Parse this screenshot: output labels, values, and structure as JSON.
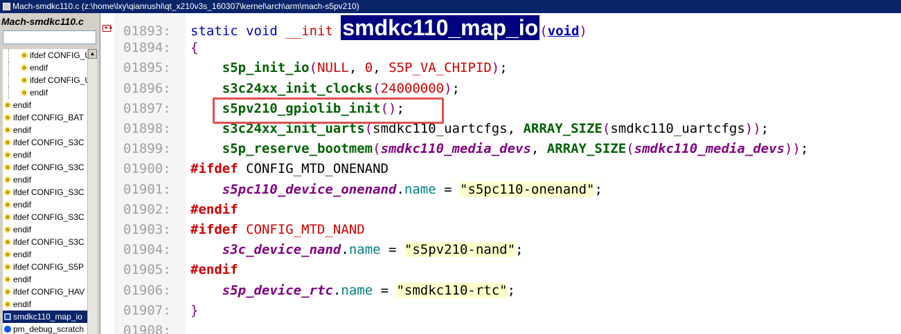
{
  "titlebar": {
    "text": "Mach-smdkc110.c (z:\\home\\lxy\\qianrushi\\qt_x210v3s_160307\\kernel\\arch\\arm\\mach-s5pv210)"
  },
  "sidebar": {
    "title": "Mach-smdkc110.c",
    "search_value": "",
    "items": [
      {
        "label": "ifdef CONFIG_U",
        "icon": "preprocessor-icon",
        "nested": true
      },
      {
        "label": "endif",
        "icon": "preprocessor-icon",
        "nested": true
      },
      {
        "label": "ifdef CONFIG_U",
        "icon": "preprocessor-icon",
        "nested": true
      },
      {
        "label": "endif",
        "icon": "preprocessor-icon",
        "nested": true
      },
      {
        "label": "endif",
        "icon": "preprocessor-icon",
        "nested": false
      },
      {
        "label": "ifdef CONFIG_BAT",
        "icon": "preprocessor-icon",
        "nested": false
      },
      {
        "label": "endif",
        "icon": "preprocessor-icon",
        "nested": false
      },
      {
        "label": "ifdef CONFIG_S3C",
        "icon": "preprocessor-icon",
        "nested": false
      },
      {
        "label": "endif",
        "icon": "preprocessor-icon",
        "nested": false
      },
      {
        "label": "ifdef CONFIG_S3C",
        "icon": "preprocessor-icon",
        "nested": false
      },
      {
        "label": "endif",
        "icon": "preprocessor-icon",
        "nested": false
      },
      {
        "label": "ifdef CONFIG_S3C",
        "icon": "preprocessor-icon",
        "nested": false
      },
      {
        "label": "endif",
        "icon": "preprocessor-icon",
        "nested": false
      },
      {
        "label": "ifdef CONFIG_S3C",
        "icon": "preprocessor-icon",
        "nested": false
      },
      {
        "label": "endif",
        "icon": "preprocessor-icon",
        "nested": false
      },
      {
        "label": "ifdef CONFIG_S3C",
        "icon": "preprocessor-icon",
        "nested": false
      },
      {
        "label": "endif",
        "icon": "preprocessor-icon",
        "nested": false
      },
      {
        "label": "ifdef CONFIG_S5P",
        "icon": "preprocessor-icon",
        "nested": false
      },
      {
        "label": "endif",
        "icon": "preprocessor-icon",
        "nested": false
      },
      {
        "label": "ifdef CONFIG_HAV",
        "icon": "preprocessor-icon",
        "nested": false
      },
      {
        "label": "endif",
        "icon": "preprocessor-icon",
        "nested": false
      },
      {
        "label": "smdkc110_map_io",
        "icon": "function-icon",
        "nested": false,
        "selected": true
      },
      {
        "label": "pm_debug_scratch",
        "icon": "variable-icon",
        "nested": false
      }
    ]
  },
  "editor": {
    "lines": [
      {
        "num": "01893:",
        "tokens": [
          [
            "kw",
            "static "
          ],
          [
            "kw",
            "void "
          ],
          [
            "mac",
            "__init "
          ],
          [
            "hl",
            "smdkc110_map_io"
          ],
          [
            "paren",
            "("
          ],
          [
            "void",
            "void"
          ],
          [
            "paren",
            ")"
          ]
        ]
      },
      {
        "num": "01894:",
        "tokens": [
          [
            "paren",
            "{"
          ]
        ]
      },
      {
        "num": "01895:",
        "tokens": [
          [
            "plain",
            "    "
          ],
          [
            "fn",
            "s5p_init_io"
          ],
          [
            "paren",
            "("
          ],
          [
            "mac",
            "NULL"
          ],
          [
            "plain",
            ", "
          ],
          [
            "num",
            "0"
          ],
          [
            "plain",
            ", "
          ],
          [
            "mac",
            "S5P_VA_CHIPID"
          ],
          [
            "paren",
            ")"
          ],
          [
            "plain",
            ";"
          ]
        ]
      },
      {
        "num": "01896:",
        "tokens": [
          [
            "plain",
            "    "
          ],
          [
            "fn",
            "s3c24xx_init_clocks"
          ],
          [
            "paren",
            "("
          ],
          [
            "num",
            "24000000"
          ],
          [
            "paren",
            ")"
          ],
          [
            "plain",
            ";"
          ]
        ]
      },
      {
        "num": "01897:",
        "tokens": [
          [
            "plain",
            "    "
          ],
          [
            "fn",
            "s5pv210_gpiolib_init"
          ],
          [
            "paren",
            "()"
          ],
          [
            "plain",
            ";"
          ]
        ]
      },
      {
        "num": "01898:",
        "tokens": [
          [
            "plain",
            "    "
          ],
          [
            "fn",
            "s3c24xx_init_uarts"
          ],
          [
            "paren",
            "("
          ],
          [
            "plain",
            "smdkc110_uartcfgs, "
          ],
          [
            "fn",
            "ARRAY_SIZE"
          ],
          [
            "paren",
            "("
          ],
          [
            "plain",
            "smdkc110_uartcfgs"
          ],
          [
            "paren",
            "))"
          ],
          [
            "plain",
            ";"
          ]
        ]
      },
      {
        "num": "01899:",
        "tokens": [
          [
            "plain",
            "    "
          ],
          [
            "fn",
            "s5p_reserve_bootmem"
          ],
          [
            "paren",
            "("
          ],
          [
            "var",
            "smdkc110_media_devs"
          ],
          [
            "plain",
            ", "
          ],
          [
            "fn",
            "ARRAY_SIZE"
          ],
          [
            "paren",
            "("
          ],
          [
            "var",
            "smdkc110_media_devs"
          ],
          [
            "paren",
            "))"
          ],
          [
            "plain",
            ";"
          ]
        ]
      },
      {
        "num": "01900:",
        "tokens": [
          [
            "pp",
            "#ifdef"
          ],
          [
            "plain",
            " CONFIG_MTD_ONENAND"
          ]
        ]
      },
      {
        "num": "01901:",
        "tokens": [
          [
            "plain",
            "    "
          ],
          [
            "var",
            "s5pc110_device_onenand"
          ],
          [
            "plain",
            "."
          ],
          [
            "mem",
            "name"
          ],
          [
            "plain",
            " = "
          ],
          [
            "str",
            "\"s5pc110-onenand\""
          ],
          [
            "plain",
            ";"
          ]
        ]
      },
      {
        "num": "01902:",
        "tokens": [
          [
            "pp",
            "#endif"
          ]
        ]
      },
      {
        "num": "01903:",
        "tokens": [
          [
            "pp",
            "#ifdef"
          ],
          [
            "mac",
            " CONFIG_MTD_NAND"
          ]
        ]
      },
      {
        "num": "01904:",
        "tokens": [
          [
            "plain",
            "    "
          ],
          [
            "var",
            "s3c_device_nand"
          ],
          [
            "plain",
            "."
          ],
          [
            "mem",
            "name"
          ],
          [
            "plain",
            " = "
          ],
          [
            "str",
            "\"s5pv210-nand\""
          ],
          [
            "plain",
            ";"
          ]
        ]
      },
      {
        "num": "01905:",
        "tokens": [
          [
            "pp",
            "#endif"
          ]
        ]
      },
      {
        "num": "01906:",
        "tokens": [
          [
            "plain",
            "    "
          ],
          [
            "var",
            "s5p_device_rtc"
          ],
          [
            "plain",
            "."
          ],
          [
            "mem",
            "name"
          ],
          [
            "plain",
            " = "
          ],
          [
            "str",
            "\"smdkc110-rtc\""
          ],
          [
            "plain",
            ";"
          ]
        ]
      },
      {
        "num": "01907:",
        "tokens": [
          [
            "paren",
            "}"
          ]
        ]
      },
      {
        "num": "01908:",
        "tokens": []
      }
    ]
  }
}
